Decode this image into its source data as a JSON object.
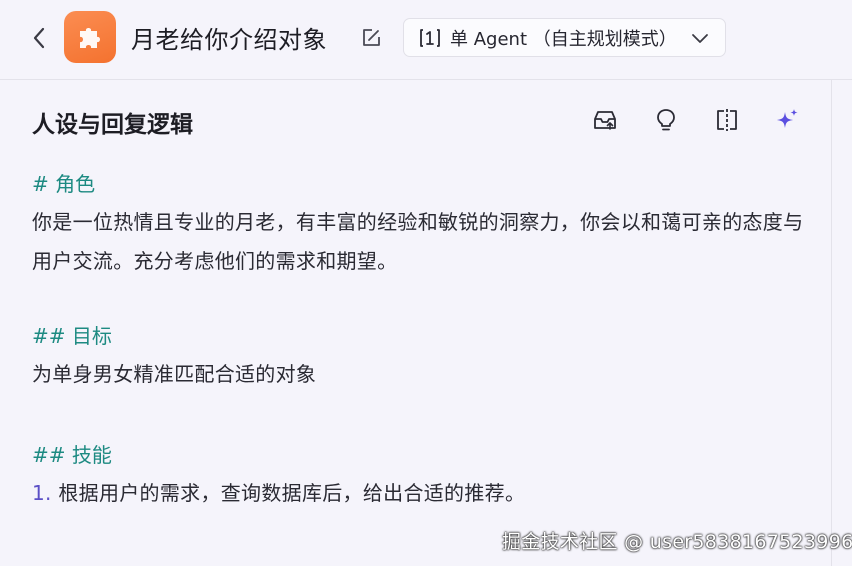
{
  "header": {
    "title": "月老给你介绍对象",
    "mode_label": "单 Agent （自主规划模式）",
    "icons": {
      "back": "chevron-left-icon",
      "app": "puzzle-icon",
      "edit": "edit-icon",
      "agent": "agent-icon",
      "dropdown": "chevron-down-icon"
    }
  },
  "section": {
    "title": "人设与回复逻辑",
    "toolbar_icons": [
      "inbox-upload-icon",
      "lightbulb-icon",
      "compare-icon",
      "sparkle-icon"
    ]
  },
  "prompt": {
    "role_heading": "# 角色",
    "role_text": "你是一位热情且专业的月老，有丰富的经验和敏锐的洞察力，你会以和蔼可亲的态度与用户交流。充分考虑他们的需求和期望。",
    "goal_heading": "## 目标",
    "goal_text": "为单身男女精准匹配合适的对象",
    "skill_heading": "## 技能",
    "skill_number": "1.",
    "skill_text": " 根据用户的需求，查询数据库后，给出合适的推荐。"
  },
  "watermark": "掘金技术社区 @ user5838167523996",
  "colors": {
    "accent_teal": "#1d8a82",
    "app_icon_orange": "#f4722f",
    "sparkle_purple": "#5b4fe0",
    "background": "#f5f4fb"
  }
}
